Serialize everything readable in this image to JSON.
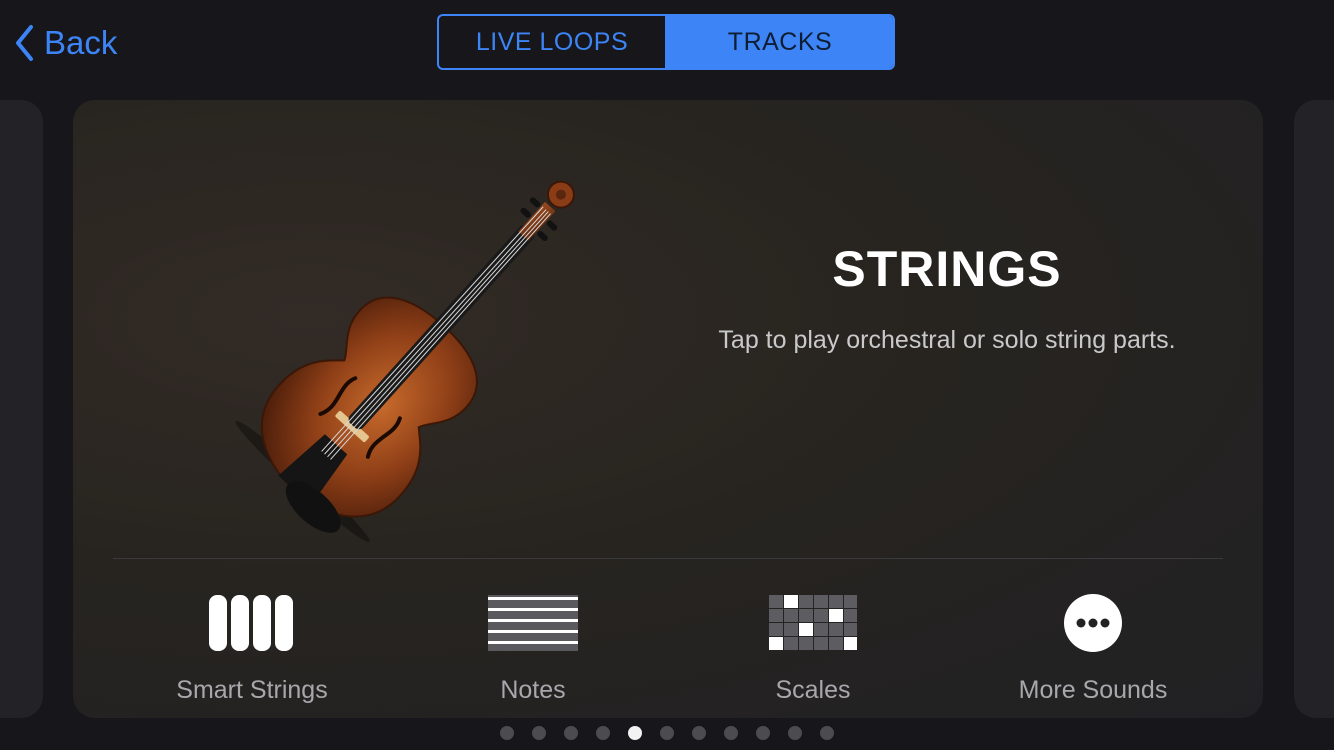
{
  "nav": {
    "back_label": "Back",
    "back_icon": "chevron-left-icon"
  },
  "segments": [
    {
      "label": "LIVE LOOPS",
      "active": false
    },
    {
      "label": "TRACKS",
      "active": true
    }
  ],
  "card": {
    "title": "STRINGS",
    "subtitle": "Tap to play orchestral or solo string parts.",
    "image": "violin-icon",
    "options": [
      {
        "label": "Smart Strings",
        "icon": "smart-strings-icon"
      },
      {
        "label": "Notes",
        "icon": "notes-icon"
      },
      {
        "label": "Scales",
        "icon": "scales-icon"
      },
      {
        "label": "More Sounds",
        "icon": "more-icon"
      }
    ]
  },
  "pager": {
    "count": 11,
    "current_index": 4
  },
  "colors": {
    "accent": "#3d85f7",
    "background": "#16161b",
    "card": "#262428"
  }
}
